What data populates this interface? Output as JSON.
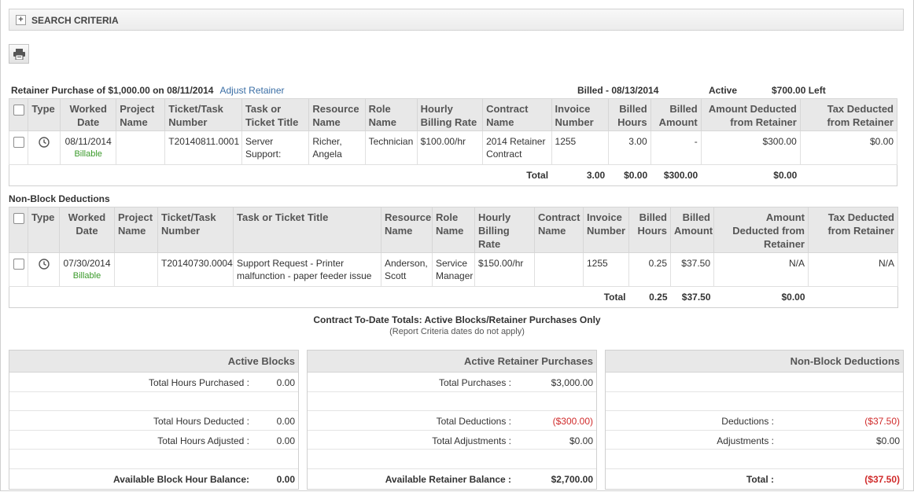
{
  "search": {
    "title": "SEARCH CRITERIA",
    "expand": "+"
  },
  "retainer": {
    "title": "Retainer Purchase of $1,000.00 on 08/11/2014",
    "adjust_link": "Adjust Retainer",
    "billed": "Billed - 08/13/2014",
    "status": "Active",
    "left": "$700.00 Left",
    "columns": [
      "Type",
      "Worked Date",
      "Project Name",
      "Ticket/Task Number",
      "Task or Ticket Title",
      "Resource Name",
      "Role Name",
      "Hourly Billing Rate",
      "Contract Name",
      "Invoice Number",
      "Billed Hours",
      "Billed Amount",
      "Amount Deducted from Retainer",
      "Tax Deducted from Retainer"
    ],
    "row": {
      "date": "08/11/2014",
      "billable": "Billable",
      "project": "",
      "ticket": "T20140811.0001",
      "title": "Server Support:",
      "resource": "Richer, Angela",
      "role": "Technician",
      "rate": "$100.00/hr",
      "contract": "2014 Retainer Contract",
      "invoice": "1255",
      "hours": "3.00",
      "amount": "-",
      "deducted": "$300.00",
      "tax": "$0.00"
    },
    "total": {
      "label": "Total",
      "hours": "3.00",
      "amount": "$0.00",
      "deducted": "$300.00",
      "tax": "$0.00"
    }
  },
  "nonblock": {
    "title": "Non-Block Deductions",
    "columns": [
      "Type",
      "Worked Date",
      "Project Name",
      "Ticket/Task Number",
      "Task or Ticket Title",
      "Resource Name",
      "Role Name",
      "Hourly Billing Rate",
      "Contract Name",
      "Invoice Number",
      "Billed Hours",
      "Billed Amount",
      "Amount Deducted from Retainer",
      "Tax Deducted from Retainer"
    ],
    "row": {
      "date": "07/30/2014",
      "billable": "Billable",
      "project": "",
      "ticket": "T20140730.0004",
      "title": "Support Request - Printer malfunction - paper feeder issue",
      "resource": "Anderson, Scott",
      "role": "Service Manager",
      "rate": "$150.00/hr",
      "contract": "",
      "invoice": "1255",
      "hours": "0.25",
      "amount": "$37.50",
      "deducted": "N/A",
      "tax": "N/A"
    },
    "total": {
      "label": "Total",
      "hours": "0.25",
      "amount": "$37.50",
      "deducted": "$0.00"
    }
  },
  "totals": {
    "title": "Contract To-Date Totals: Active Blocks/Retainer Purchases Only",
    "subtitle": "(Report Criteria dates do not apply)",
    "active_blocks": {
      "header": "Active Blocks",
      "purchased_label": "Total Hours Purchased :",
      "purchased": "0.00",
      "deducted_label": "Total Hours Deducted :",
      "deducted": "0.00",
      "adjusted_label": "Total Hours Adjusted :",
      "adjusted": "0.00",
      "balance_label": "Available Block Hour Balance:",
      "balance": "0.00"
    },
    "retainer": {
      "header": "Active Retainer Purchases",
      "purchases_label": "Total Purchases :",
      "purchases": "$3,000.00",
      "deductions_label": "Total Deductions :",
      "deductions": "($300.00)",
      "adjustments_label": "Total Adjustments :",
      "adjustments": "$0.00",
      "balance_label": "Available Retainer Balance :",
      "balance": "$2,700.00"
    },
    "nonblock": {
      "header": "Non-Block Deductions",
      "deductions_label": "Deductions :",
      "deductions": "($37.50)",
      "adjustments_label": "Adjustments :",
      "adjustments": "$0.00",
      "total_label": "Total :",
      "total": "($37.50)"
    }
  },
  "colors": {
    "link": "#3a6ea5",
    "billable": "#3a9a2a",
    "negative": "#d02b2b",
    "header_bg": "#e8e8e8"
  }
}
